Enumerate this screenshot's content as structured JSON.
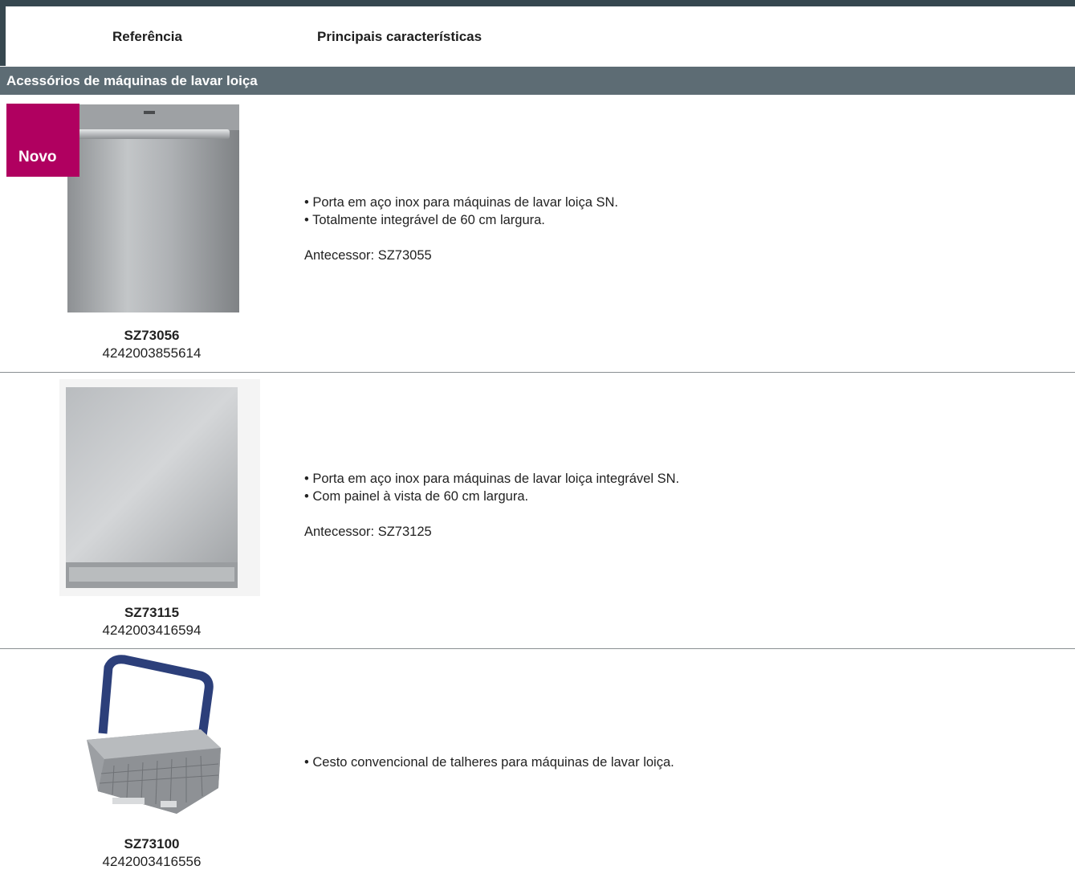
{
  "header": {
    "col_reference": "Referência",
    "col_features": "Principais características"
  },
  "section": {
    "title": "Acessórios de máquinas de lavar loiça"
  },
  "products": [
    {
      "badge": "Novo",
      "model": "SZ73056",
      "ean": "4242003855614",
      "features": [
        "• Porta em aço inox para máquinas de lavar loiça SN.",
        "• Totalmente integrável de 60 cm largura."
      ],
      "predecessor": "Antecessor: SZ73055"
    },
    {
      "model": "SZ73115",
      "ean": "4242003416594",
      "features": [
        "• Porta em aço inox para máquinas de lavar loiça integrável SN.",
        "• Com painel à vista de 60 cm largura."
      ],
      "predecessor": "Antecessor: SZ73125"
    },
    {
      "model": "SZ73100",
      "ean": "4242003416556",
      "features": [
        "• Cesto convencional de talheres para máquinas de lavar loiça."
      ]
    }
  ],
  "colors": {
    "header_band": "#36474f",
    "section_bar": "#5d6c74",
    "badge": "#b00060"
  }
}
